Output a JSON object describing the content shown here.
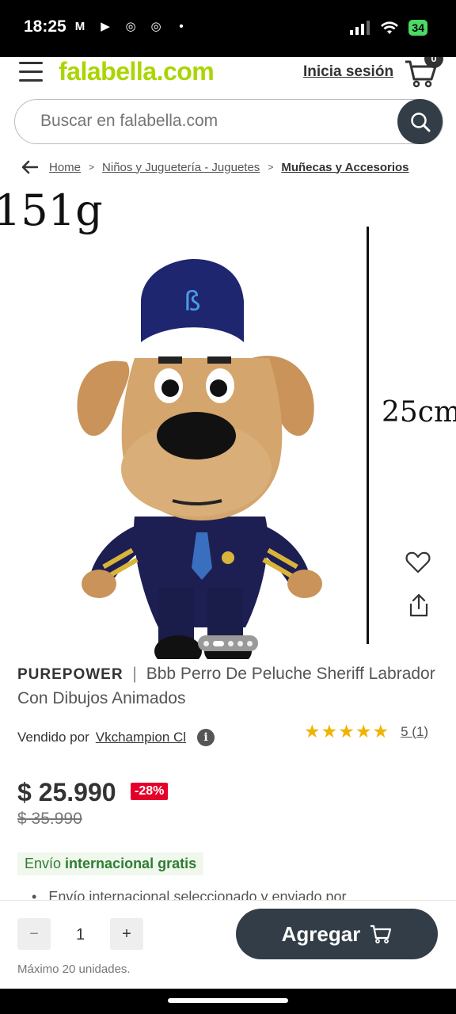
{
  "status_bar": {
    "time": "18:25",
    "apps": [
      "M",
      "▶",
      "◎",
      "◎"
    ],
    "dot": "•",
    "battery": "34"
  },
  "header": {
    "logo": "falabella.com",
    "login_label": "Inicia sesión",
    "cart_count": "0"
  },
  "search": {
    "placeholder": "Buscar en falabella.com"
  },
  "breadcrumb": {
    "items": [
      "Home",
      "Niños y Juguetería - Juguetes",
      "Muñecas y Accesorios"
    ]
  },
  "image_overlay": {
    "weight": "151g",
    "size": "25cm",
    "carousel_total": 5,
    "carousel_active": 1
  },
  "product": {
    "brand": "PUREPOWER",
    "separator": "|",
    "title": "Bbb Perro De Peluche Sheriff Labrador Con Dibujos Animados",
    "seller_label": "Vendido por",
    "seller_name": "Vkchampion Cl",
    "rating_value": 5,
    "rating_text": "5 (1)",
    "price": "$ 25.990",
    "discount": "-28%",
    "old_price": "$ 35.990",
    "shipping_prefix": "Envío",
    "shipping_bold": "internacional gratis",
    "shipping_bullet": "Envío internacional seleccionado y enviado por"
  },
  "purchase": {
    "minus": "−",
    "quantity": "1",
    "plus": "+",
    "add_label": "Agregar",
    "max_note": "Máximo 20 unidades."
  },
  "colors": {
    "brand_green": "#aad500",
    "primary_dark": "#333d47",
    "discount_red": "#e4002b",
    "star_yellow": "#f0b400",
    "shipping_green": "#2e7d32"
  }
}
